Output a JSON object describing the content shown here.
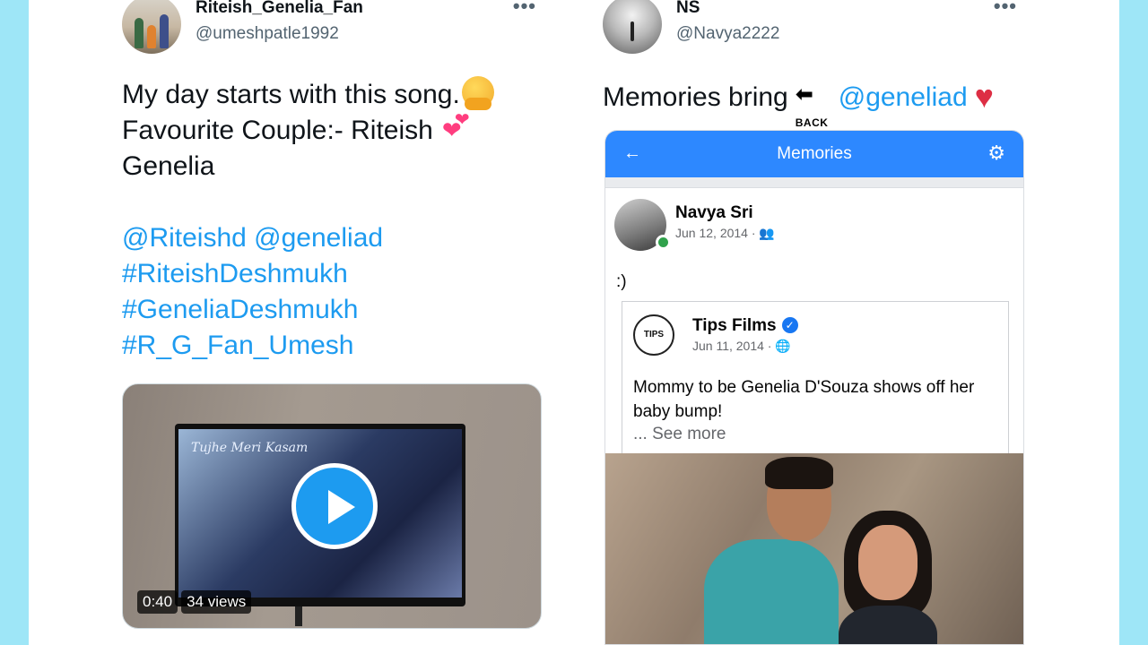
{
  "tweets": [
    {
      "author_name": "Riteish_Genelia_Fan",
      "handle": "@umeshpatle1992",
      "more_label": "•••",
      "text_line1": "My day starts with this song.",
      "text_line2": "Favourite Couple:- Riteish",
      "text_line3": "Genelia",
      "mentions": "@Riteishd @geneliad",
      "hashtags": [
        "#RiteishDeshmukh",
        "#GeneliaDeshmukh",
        "#R_G_Fan_Umesh"
      ],
      "video": {
        "duration": "0:40",
        "views": "34 views",
        "screen_title": "Tujhe Meri Kasam"
      }
    },
    {
      "author_name": "NS",
      "handle": "@Navya2222",
      "more_label": "•••",
      "text_prefix": "Memories bring",
      "back_label": "BACK",
      "mention": "@geneliad",
      "fb_memory": {
        "bar_title": "Memories",
        "poster_name": "Navya Sri",
        "poster_date": "Jun 12, 2014 · 👥",
        "post_text": ":)",
        "shared": {
          "page_name": "Tips Films",
          "page_date": "Jun 11, 2014 · 🌐",
          "logo_text": "TIPS",
          "body": "Mommy to be Genelia D'Souza shows off her baby bump!",
          "see_more": "... See more"
        }
      }
    }
  ],
  "colors": {
    "twitter_blue": "#1d9bf0",
    "facebook_blue": "#2d88ff",
    "background_cyan": "#9ee6f7"
  },
  "icons": {
    "more": "ellipsis-icon",
    "play": "play-icon",
    "back_arrow": "back-arrow-icon",
    "heart": "red-heart-icon",
    "settings": "gear-icon",
    "verified": "verified-badge-icon"
  }
}
